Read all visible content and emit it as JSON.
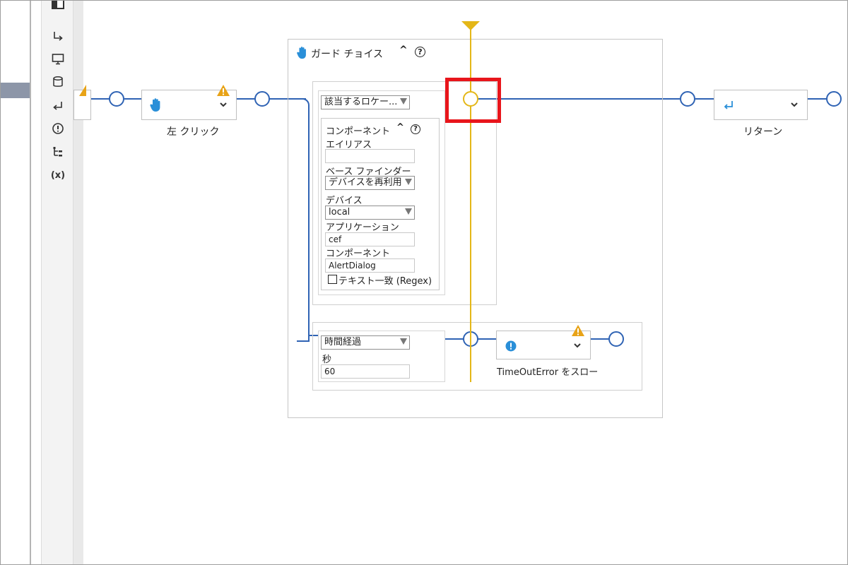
{
  "sidebar": {
    "icons": [
      "panel-icon",
      "step-into-icon",
      "monitor-icon",
      "database-icon",
      "return-icon",
      "exclamation-icon",
      "hierarchy-icon",
      "variable-icon"
    ],
    "variable_label": "(x)"
  },
  "nodes": {
    "left_click": {
      "label": "左 クリック"
    },
    "return": {
      "label": "リターン"
    },
    "throw": {
      "label": "TimeOutError をスロー"
    }
  },
  "guard_choice": {
    "title": "ガード チョイス",
    "collapse_glyph": "^",
    "help_glyph": "?",
    "branch1": {
      "condition": "該当するロケー...",
      "component_group": {
        "title": "コンポーネント",
        "alias_label": "エイリアス",
        "alias_value": "",
        "base_finder_label": "ベース ファインダー",
        "base_finder_value": "デバイスを再利用",
        "device_label": "デバイス",
        "device_value": "local",
        "application_label": "アプリケーション",
        "application_value": "cef",
        "component_label": "コンポーネント",
        "component_value": "AlertDialog",
        "regex_label": "テキスト一致 (Regex)",
        "regex_checked": false
      }
    },
    "branch2": {
      "condition": "時間経過",
      "seconds_label": "秒",
      "seconds_value": "60"
    }
  },
  "colors": {
    "wire": "#2f63b4",
    "guide": "#e4b718",
    "highlight": "#e8151b",
    "warning": "#e8a317",
    "icon_blue": "#2a8fd8"
  }
}
